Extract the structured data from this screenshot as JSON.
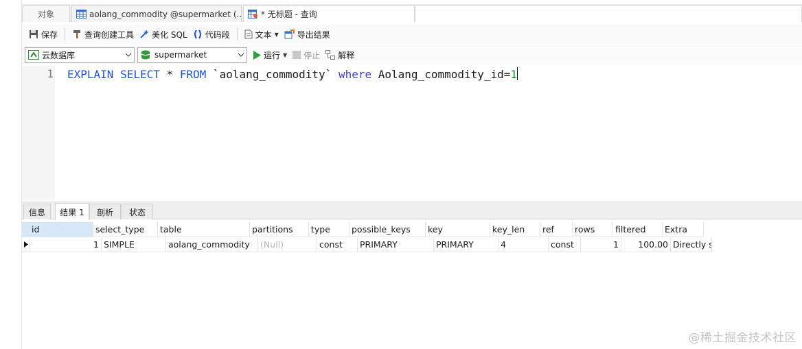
{
  "tabs": {
    "objects_label": "对象",
    "table_tab_label": "aolang_commodity @supermarket (...",
    "query_tab_label": "* 无标题 - 查询"
  },
  "toolbar1": {
    "save": "保存",
    "query_builder": "查询创建工具",
    "beautify": "美化 SQL",
    "snippet": "代码段",
    "text": "文本",
    "export": "导出结果"
  },
  "toolbar2": {
    "connection": "云数据库",
    "database": "supermarket",
    "run": "运行",
    "stop": "停止",
    "explain": "解释"
  },
  "editor": {
    "line_number": "1",
    "code": {
      "kw1": "EXPLAIN SELECT",
      "t1": " * ",
      "kw2": "FROM",
      "t2": " `aolang_commodity` ",
      "kw3": "where",
      "t3": " Aolang_commodity_id=",
      "num": "1"
    }
  },
  "result_tabs": [
    "信息",
    "结果 1",
    "剖析",
    "状态"
  ],
  "result_active_tab": 1,
  "result_grid": {
    "columns": [
      "id",
      "select_type",
      "table",
      "partitions",
      "type",
      "possible_keys",
      "key",
      "key_len",
      "ref",
      "rows",
      "filtered",
      "Extra"
    ],
    "rows": [
      [
        "1",
        "SIMPLE",
        "aolang_commodity",
        "(Null)",
        "const",
        "PRIMARY",
        "PRIMARY",
        "4",
        "const",
        "1",
        "100.00",
        "Directly se"
      ]
    ]
  },
  "watermark": "@稀土掘金技术社区",
  "colors": {
    "keyword": "#1f4fd8",
    "number": "#0d8a22",
    "header_selected": "#d6e7f7",
    "null_text": "#b5b5b5"
  }
}
